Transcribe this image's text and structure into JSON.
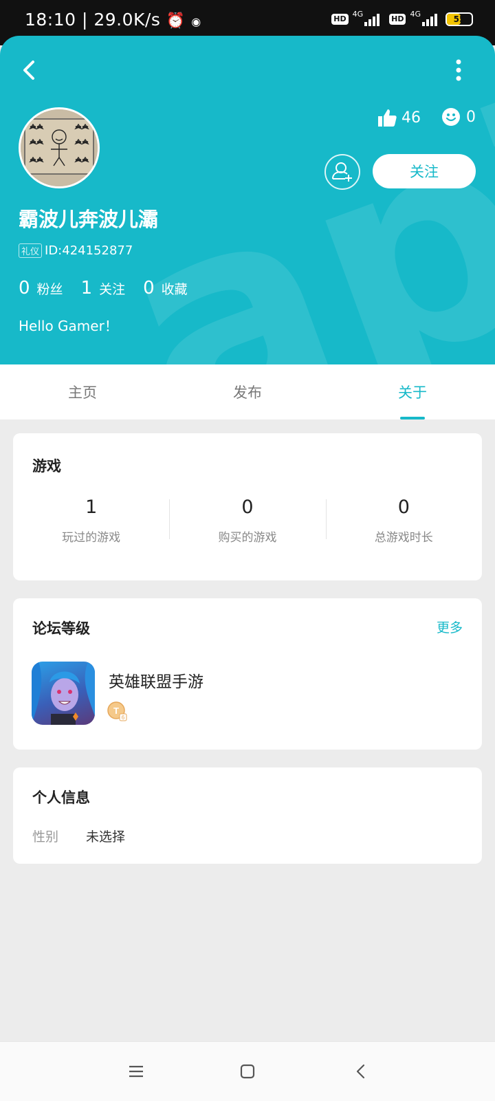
{
  "status_bar": {
    "time": "18:10",
    "speed": "29.0K/s",
    "sim1_badge": "HD",
    "sim1_net": "4G",
    "sim2_badge": "HD",
    "sim2_net": "4G",
    "battery": "55"
  },
  "profile": {
    "username": "霸波儿奔波儿灞",
    "etiquette_tag": "礼仪",
    "id_text": "ID:424152877",
    "likes": "46",
    "face_count": "0",
    "follow_label": "关注",
    "stats": [
      {
        "value": "0",
        "label": "粉丝"
      },
      {
        "value": "1",
        "label": "关注"
      },
      {
        "value": "0",
        "label": "收藏"
      }
    ],
    "bio": "Hello Gamer！",
    "watermark": "apTa"
  },
  "tabs": [
    {
      "label": "主页",
      "active": false
    },
    {
      "label": "发布",
      "active": false
    },
    {
      "label": "关于",
      "active": true
    }
  ],
  "games_card": {
    "title": "游戏",
    "stats": [
      {
        "value": "1",
        "label": "玩过的游戏"
      },
      {
        "value": "0",
        "label": "购买的游戏"
      },
      {
        "value": "0",
        "label": "总游戏时长"
      }
    ]
  },
  "forum_card": {
    "title": "论坛等级",
    "more_label": "更多",
    "game_name": "英雄联盟手游"
  },
  "info_card": {
    "title": "个人信息",
    "gender_key": "性别",
    "gender_value": "未选择"
  },
  "colors": {
    "accent": "#17b9c9",
    "background": "#ececec"
  }
}
